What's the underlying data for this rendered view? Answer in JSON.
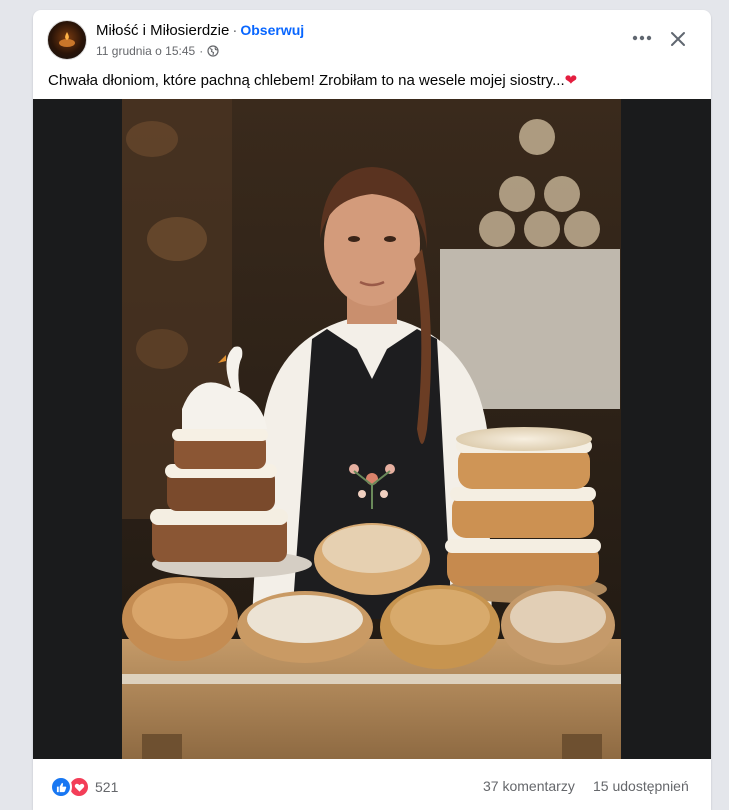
{
  "post": {
    "page_name": "Miłość i Miłosierdzie",
    "separator": "·",
    "follow_label": "Obserwuj",
    "timestamp": "11 grudnia o 15:45",
    "timestamp_sep": "·",
    "audience_icon": "globe-icon",
    "caption": "Chwała dłoniom, które pachną chlebem! Zrobiłam to na wesele mojej siostry...",
    "caption_emoji": "❤"
  },
  "actions": {
    "more_icon": "more-options-icon",
    "close_icon": "close-icon"
  },
  "footer": {
    "reaction_count": "521",
    "comments": "37 komentarzy",
    "shares": "15 udostępnień"
  },
  "colors": {
    "accent": "#0866ff",
    "like": "#1877f2",
    "love": "#f33e58",
    "secondary_text": "#65676b"
  }
}
